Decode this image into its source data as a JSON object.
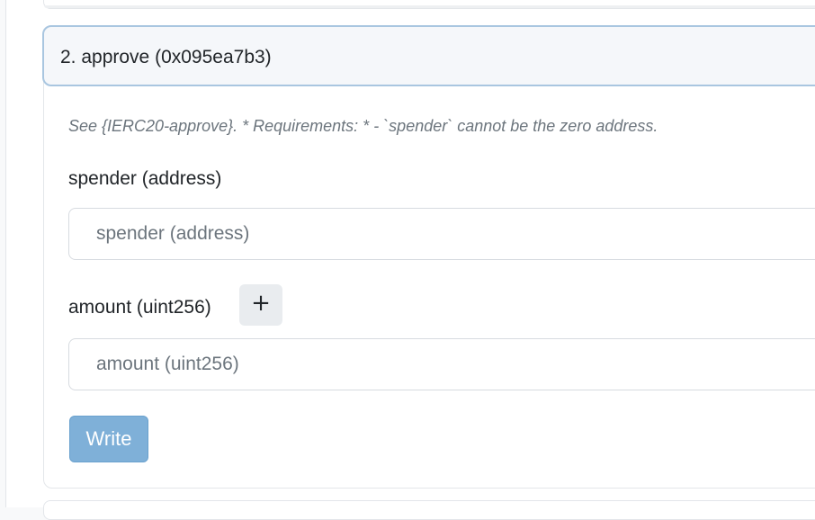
{
  "function_card": {
    "title": "2. approve (0x095ea7b3)",
    "description": "See {IERC20-approve}. * Requirements: * - `spender` cannot be the zero address.",
    "inputs": [
      {
        "label": "spender (address)",
        "placeholder": "spender (address)",
        "value": ""
      },
      {
        "label": "amount (uint256)",
        "placeholder": "amount (uint256)",
        "value": "",
        "add_button_label": "+"
      }
    ],
    "write_label": "Write"
  },
  "colors": {
    "header_border": "#a9c6e0",
    "write_button": "#7fb0d8",
    "muted_text": "#6c757d"
  },
  "icons": {
    "add_decimals": "plus-icon"
  }
}
